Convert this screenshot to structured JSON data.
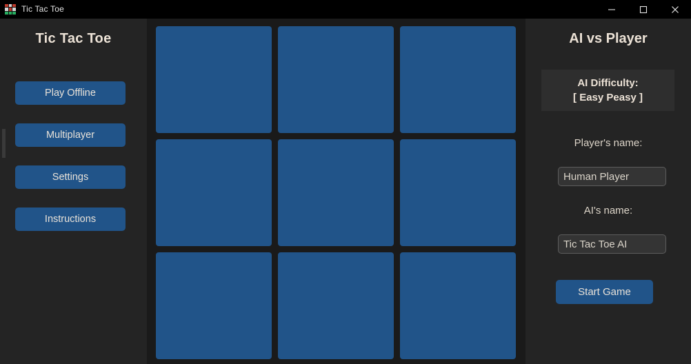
{
  "window": {
    "title": "Tic Tac Toe",
    "icon": "tic-tac-toe-grid-icon",
    "controls": {
      "minimize": "minimize-icon",
      "maximize": "maximize-icon",
      "close": "close-icon"
    }
  },
  "colors": {
    "titlebar_bg": "#000000",
    "panel_bg": "#242424",
    "board_bg": "#1a1a1a",
    "accent_blue": "#215489",
    "text_cream": "#ece2d6",
    "difficulty_box_bg": "#2e2e2e",
    "input_bg": "#343434",
    "input_border": "#5d5d5d"
  },
  "sidebar": {
    "title": "Tic Tac Toe",
    "buttons": [
      {
        "label": "Play Offline"
      },
      {
        "label": "Multiplayer"
      },
      {
        "label": "Settings"
      },
      {
        "label": "Instructions"
      }
    ]
  },
  "board": {
    "rows": 3,
    "columns": 3,
    "cells": [
      "",
      "",
      "",
      "",
      "",
      "",
      "",
      "",
      ""
    ]
  },
  "right_panel": {
    "title": "AI vs Player",
    "difficulty": {
      "label": "AI Difficulty:",
      "value": "[ Easy Peasy ]"
    },
    "player_name": {
      "label": "Player's name:",
      "value": "Human Player",
      "placeholder": "Player's name"
    },
    "ai_name": {
      "label": "AI's name:",
      "value": "Tic Tac Toe AI",
      "placeholder": "AI's name"
    },
    "start_button": "Start Game"
  }
}
